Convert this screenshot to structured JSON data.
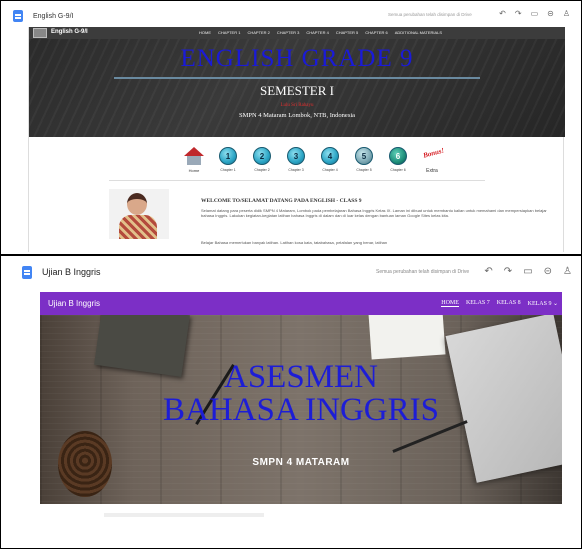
{
  "top": {
    "doc_title": "English G-9/I",
    "status": "Semua perubahan telah disimpan di Drive",
    "toolbar_icons": [
      "undo-icon",
      "redo-icon",
      "preview-icon",
      "link-icon",
      "add-person-icon"
    ],
    "site": {
      "brand": "English G-9/I",
      "nav": [
        "HOME",
        "CHAPTER 1",
        "CHAPTER 2",
        "CHAPTER 3",
        "CHAPTER 4",
        "CHAPTER 5",
        "CHAPTER 6",
        "ADDITIONAL MATERIALS"
      ],
      "hero": {
        "title": "ENGLISH GRADE 9",
        "semester": "SEMESTER I",
        "author": "Lulu Sri Rahayu",
        "school": "SMPN 4 Mataram Lombok, NTB, Indonesia"
      },
      "chapters": [
        {
          "label": "Home",
          "icon": "home-icon"
        },
        {
          "num": "1",
          "label": "Chapter 1"
        },
        {
          "num": "2",
          "label": "Chapter 2"
        },
        {
          "num": "3",
          "label": "Chapter 3"
        },
        {
          "num": "4",
          "label": "Chapter 4"
        },
        {
          "num": "5",
          "label": "Chapter 5"
        },
        {
          "num": "6",
          "label": "Chapter 6"
        },
        {
          "label": "Extra",
          "badge": "Bonus!"
        }
      ],
      "welcome_heading": "WELCOME TO/SELAMAT DATANG PADA ENGLISH - CLASS 9",
      "paragraph_1": "Selamat datang para peserta didik SMPN 4 Mataram, Lombok pada pembelajaran Bahasa Inggris Kelas IX. Laman ini dibuat untuk membantu kalian untuk memahami dan mempersiapkan belajar bahasa Inggris. Lakukan kegiatan-kegiatan latihan bahasa Inggris di dalam dan di luar kelas dengan bantuan laman Google Sites kelas kita.",
      "paragraph_2": "Belajar Bahasa memerlukan banyak latihan. Latihan kosa kata, tatabahasa, pelafalan yang benar, latihan"
    }
  },
  "bottom": {
    "doc_title": "Ujian B Inggris",
    "status": "Semua perubahan telah disimpan di Drive",
    "toolbar_icons": [
      "undo-icon",
      "redo-icon",
      "preview-icon",
      "link-icon",
      "add-person-icon"
    ],
    "site": {
      "brand": "Ujian B Inggris",
      "nav": [
        "HOME",
        "KELAS 7",
        "KELAS 8",
        "KELAS 9 ⌄"
      ],
      "hero_title_line1": "ASESMEN",
      "hero_title_line2": "BAHASA INGGRIS",
      "hero_subtitle": "SMPN 4 MATARAM"
    }
  },
  "colors": {
    "top_nav": "#3c3c3c",
    "top_title": "#1a1ad8",
    "bottom_nav": "#7c2fc6",
    "bottom_title": "#1d1dd6"
  }
}
